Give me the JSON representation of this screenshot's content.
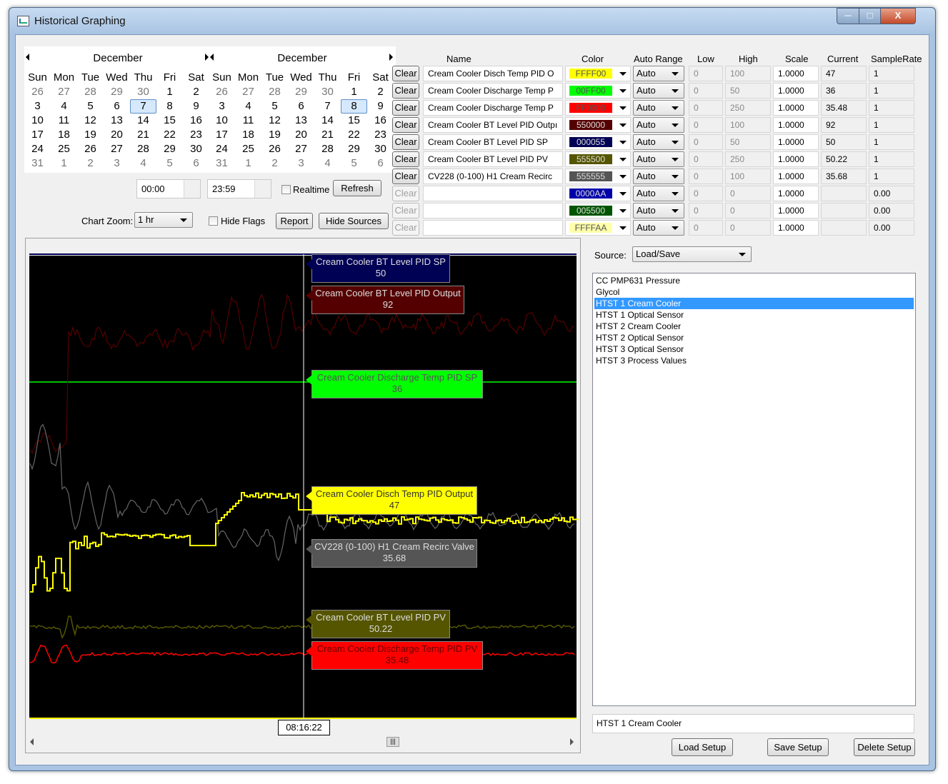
{
  "window": {
    "title": "Historical Graphing",
    "min_glyph": "─",
    "max_glyph": "□",
    "close_glyph": "X"
  },
  "calendar_left": {
    "month": "December",
    "weekdays": [
      "Sun",
      "Mon",
      "Tue",
      "Wed",
      "Thu",
      "Fri",
      "Sat"
    ],
    "days": [
      "26",
      "27",
      "28",
      "29",
      "30",
      "1",
      "2",
      "3",
      "4",
      "5",
      "6",
      "7",
      "8",
      "9",
      "10",
      "11",
      "12",
      "13",
      "14",
      "15",
      "16",
      "17",
      "18",
      "19",
      "20",
      "21",
      "22",
      "23",
      "24",
      "25",
      "26",
      "27",
      "28",
      "29",
      "30",
      "31",
      "1",
      "2",
      "3",
      "4",
      "5",
      "6"
    ],
    "selected": "7"
  },
  "calendar_right": {
    "month": "December",
    "weekdays": [
      "Sun",
      "Mon",
      "Tue",
      "Wed",
      "Thu",
      "Fri",
      "Sat"
    ],
    "days": [
      "26",
      "27",
      "28",
      "29",
      "30",
      "1",
      "2",
      "3",
      "4",
      "5",
      "6",
      "7",
      "8",
      "9",
      "10",
      "11",
      "12",
      "13",
      "14",
      "15",
      "16",
      "17",
      "18",
      "19",
      "20",
      "21",
      "22",
      "23",
      "24",
      "25",
      "26",
      "27",
      "28",
      "29",
      "30",
      "31",
      "1",
      "2",
      "3",
      "4",
      "5",
      "6"
    ],
    "selected": "8"
  },
  "controls": {
    "start_time": "00:00",
    "end_time": "23:59",
    "realtime_label": "Realtime",
    "refresh_label": "Refresh",
    "chart_zoom_label": "Chart Zoom:",
    "chart_zoom_value": "1 hr",
    "hide_flags_label": "Hide Flags",
    "report_label": "Report",
    "hide_sources_label": "Hide Sources"
  },
  "table": {
    "headers": {
      "name": "Name",
      "color": "Color",
      "auto_range": "Auto Range",
      "low": "Low",
      "high": "High",
      "scale": "Scale",
      "current": "Current",
      "sample_rate": "SampleRate"
    },
    "clear_label": "Clear",
    "rows": [
      {
        "name": "Cream Cooler Disch Temp PID O",
        "color": "FFFF00",
        "color_hex": "#ffff00",
        "text_color": "#555555",
        "range": "Auto",
        "low": "0",
        "high": "100",
        "scale": "1.0000",
        "current": "47",
        "rate": "1",
        "enabled": true
      },
      {
        "name": "Cream Cooler Discharge Temp P",
        "color": "00FF00",
        "color_hex": "#00ff00",
        "text_color": "#555555",
        "range": "Auto",
        "low": "0",
        "high": "50",
        "scale": "1.0000",
        "current": "36",
        "rate": "1",
        "enabled": true
      },
      {
        "name": "Cream Cooler Discharge Temp P",
        "color": "FF0000",
        "color_hex": "#ff0000",
        "text_color": "#555555",
        "range": "Auto",
        "low": "0",
        "high": "250",
        "scale": "1.0000",
        "current": "35.48",
        "rate": "1",
        "enabled": true
      },
      {
        "name": "Cream Cooler BT Level PID Outpı",
        "color": "550000",
        "color_hex": "#550000",
        "text_color": "#dddddd",
        "range": "Auto",
        "low": "0",
        "high": "100",
        "scale": "1.0000",
        "current": "92",
        "rate": "1",
        "enabled": true
      },
      {
        "name": "Cream Cooler BT Level PID SP",
        "color": "000055",
        "color_hex": "#000055",
        "text_color": "#dddddd",
        "range": "Auto",
        "low": "0",
        "high": "50",
        "scale": "1.0000",
        "current": "50",
        "rate": "1",
        "enabled": true
      },
      {
        "name": "Cream Cooler BT Level PID PV",
        "color": "555500",
        "color_hex": "#555500",
        "text_color": "#dddddd",
        "range": "Auto",
        "low": "0",
        "high": "250",
        "scale": "1.0000",
        "current": "50.22",
        "rate": "1",
        "enabled": true
      },
      {
        "name": "CV228 (0-100) H1 Cream Recirc",
        "color": "555555",
        "color_hex": "#555555",
        "text_color": "#dddddd",
        "range": "Auto",
        "low": "0",
        "high": "100",
        "scale": "1.0000",
        "current": "35.68",
        "rate": "1",
        "enabled": true
      },
      {
        "name": "",
        "color": "0000AA",
        "color_hex": "#0000aa",
        "text_color": "#dddddd",
        "range": "Auto",
        "low": "0",
        "high": "0",
        "scale": "1.0000",
        "current": "",
        "rate": "0.00",
        "enabled": false
      },
      {
        "name": "",
        "color": "005500",
        "color_hex": "#005500",
        "text_color": "#dddddd",
        "range": "Auto",
        "low": "0",
        "high": "0",
        "scale": "1.0000",
        "current": "",
        "rate": "0.00",
        "enabled": false
      },
      {
        "name": "",
        "color": "FFFFAA",
        "color_hex": "#ffffaa",
        "text_color": "#555555",
        "range": "Auto",
        "low": "0",
        "high": "0",
        "scale": "1.0000",
        "current": "",
        "rate": "0.00",
        "enabled": false
      }
    ]
  },
  "chart": {
    "cursor_time": "08:16:22",
    "flags": [
      {
        "name": "Cream Cooler BT Level PID SP",
        "value": "50",
        "bg": "#000055",
        "fg": "#dddddd"
      },
      {
        "name": "Cream Cooler BT Level PID Output",
        "value": "92",
        "bg": "#550000",
        "fg": "#dddddd"
      },
      {
        "name": "Cream Cooler Discharge Temp PID SP",
        "value": "36",
        "bg": "#00ff00",
        "fg": "#555555"
      },
      {
        "name": "Cream Cooler Disch Temp PID Output",
        "value": "47",
        "bg": "#ffff00",
        "fg": "#333333"
      },
      {
        "name": "CV228 (0-100) H1 Cream Recirc Valve",
        "value": "35.68",
        "bg": "#555555",
        "fg": "#dddddd"
      },
      {
        "name": "Cream Cooler BT Level PID PV",
        "value": "50.22",
        "bg": "#555500",
        "fg": "#dddddd"
      },
      {
        "name": "Cream Cooler Discharge Temp PID PV",
        "value": "35.48",
        "bg": "#ff0000",
        "fg": "#660000"
      }
    ]
  },
  "sources": {
    "label": "Source:",
    "selected": "Load/Save",
    "items": [
      "CC PMP631 Pressure",
      "Glycol",
      "HTST 1 Cream Cooler",
      "HTST 1 Optical Sensor",
      "HTST 2 Cream Cooler",
      "HTST 2 Optical Sensor",
      "HTST 3 Optical Sensor",
      "HTST 3 Process Values"
    ],
    "selected_item": "HTST 1 Cream Cooler",
    "name_field": "HTST 1 Cream Cooler",
    "load_label": "Load Setup",
    "save_label": "Save Setup",
    "delete_label": "Delete Setup"
  }
}
